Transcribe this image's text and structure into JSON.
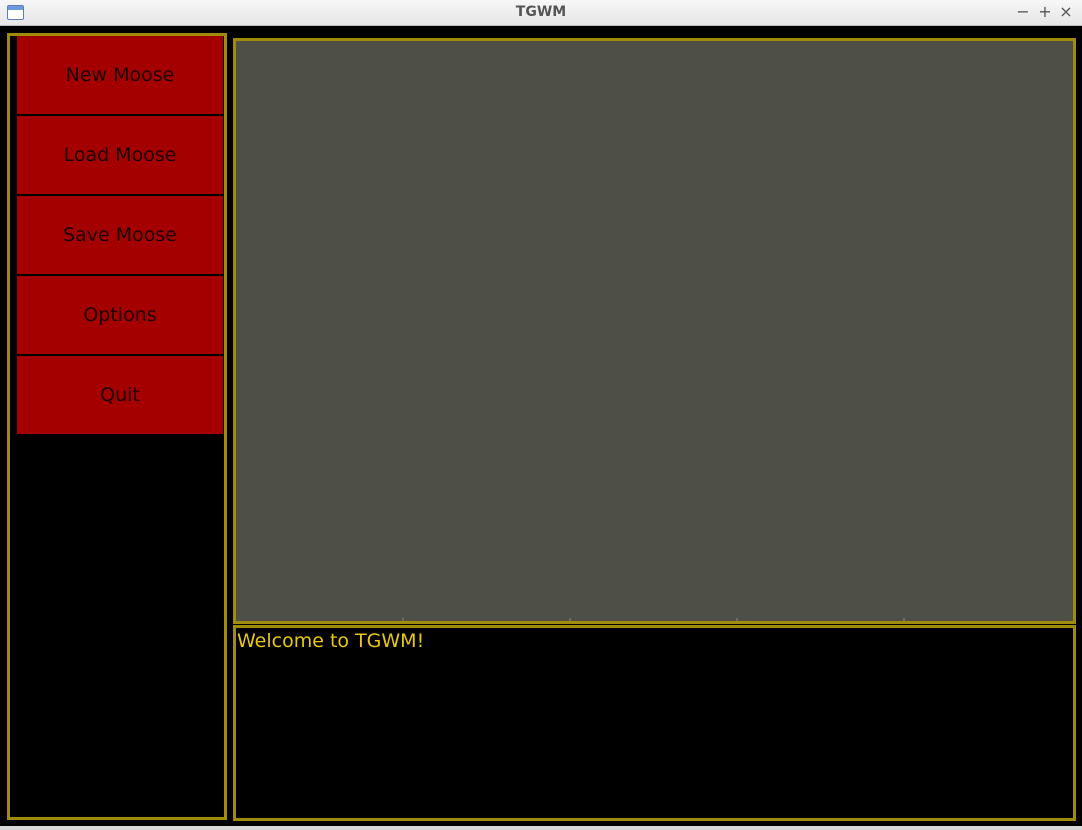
{
  "window": {
    "title": "TGWM",
    "controls": {
      "minimize": "−",
      "maximize": "+",
      "close": "×"
    }
  },
  "menu": {
    "items": [
      {
        "label": "New Moose"
      },
      {
        "label": "Load Moose"
      },
      {
        "label": "Save Moose"
      },
      {
        "label": "Options"
      },
      {
        "label": "Quit"
      }
    ]
  },
  "console": {
    "lines": [
      "Welcome to TGWM!"
    ]
  },
  "colors": {
    "border_gold": "#a08c0a",
    "button_red": "#a50000",
    "viewport_gray": "#4e5047",
    "console_text": "#e8c90f",
    "background": "#000000"
  }
}
